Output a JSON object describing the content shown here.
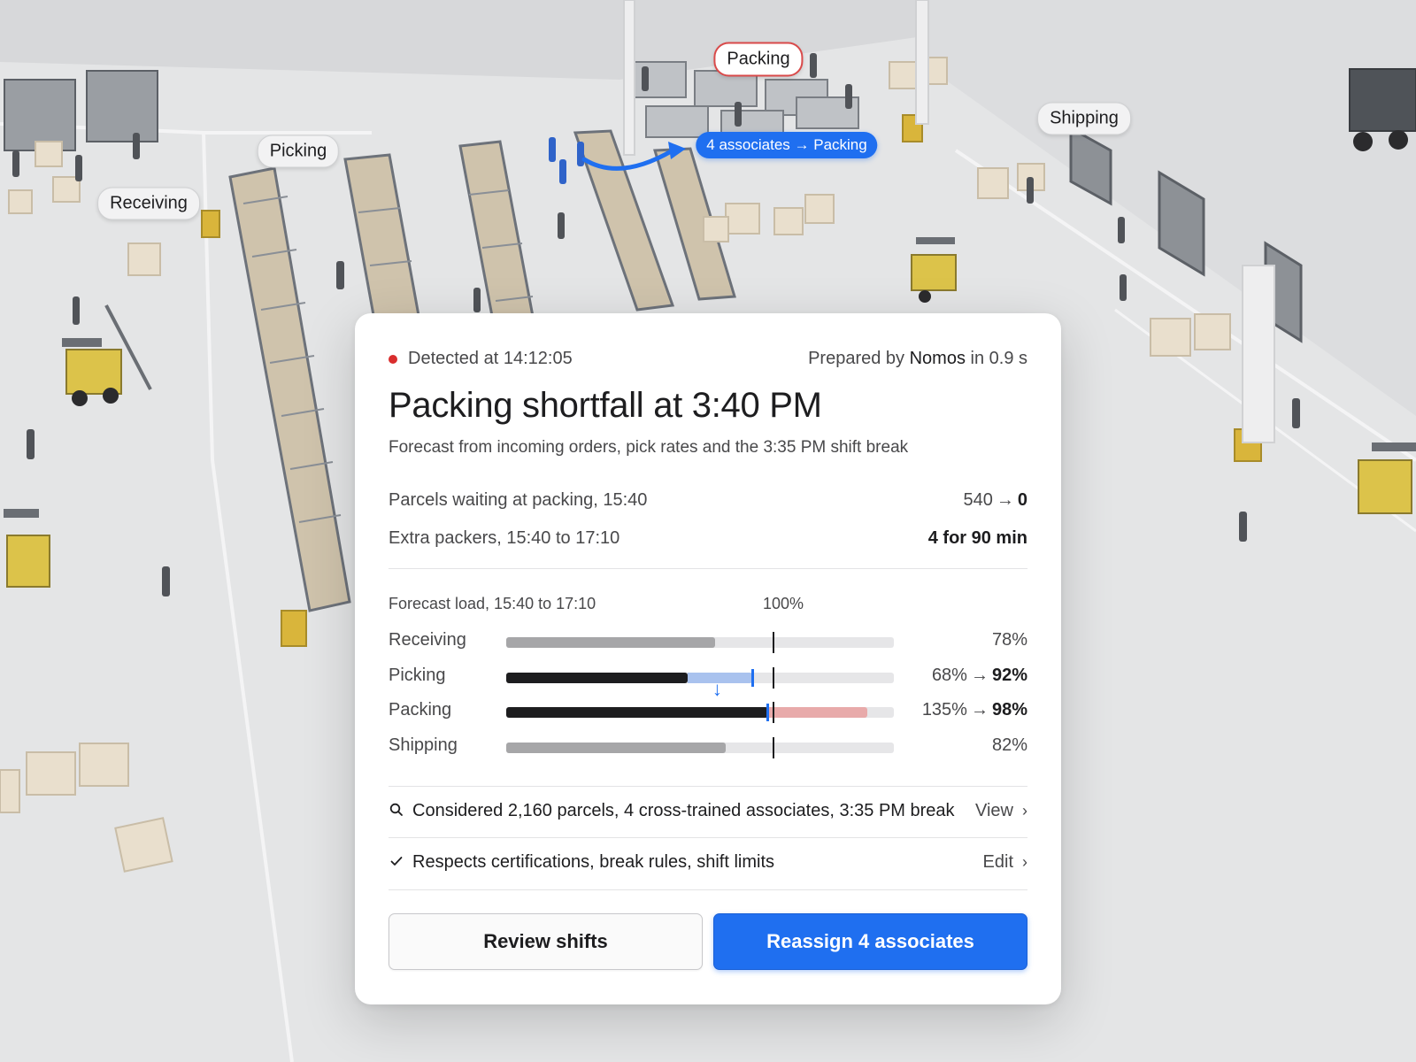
{
  "map": {
    "zones": {
      "receiving": "Receiving",
      "picking": "Picking",
      "packing": "Packing",
      "shipping": "Shipping"
    },
    "move_pill": "4 associates → Packing"
  },
  "card": {
    "detected": "Detected at 14:12:05",
    "prepared_prefix": "Prepared by ",
    "prepared_brand": "Nomos",
    "prepared_suffix": " in 0.9 s",
    "title": "Packing shortfall at 3:40 PM",
    "subtitle": "Forecast from incoming orders, pick rates and the 3:35 PM shift break",
    "stats": [
      {
        "label": "Parcels waiting at packing, 15:40",
        "from": "540",
        "arrow": "→",
        "to": "0"
      },
      {
        "label": "Extra packers, 15:40 to 17:10",
        "value": "4 for 90 min"
      }
    ],
    "load": {
      "header": "Forecast load, 15:40 to 17:10",
      "reference_label": "100%",
      "reference": 1.0,
      "max": 1.45,
      "rows": [
        {
          "label": "Receiving",
          "current": 0.78,
          "text": "78%"
        },
        {
          "label": "Picking",
          "current": 0.68,
          "after": 0.92,
          "text_from": "68%",
          "arrow": "→",
          "text_to": "92%"
        },
        {
          "label": "Packing",
          "current": 1.35,
          "after": 0.98,
          "text_from": "135%",
          "arrow": "→",
          "text_to": "98%"
        },
        {
          "label": "Shipping",
          "current": 0.82,
          "text": "82%"
        }
      ],
      "transfer_arrow": "↓"
    },
    "considered": {
      "icon": "search-icon",
      "text": "Considered 2,160 parcels, 4 cross-trained associates, 3:35 PM break",
      "link": "View"
    },
    "constraints": {
      "icon": "check-icon",
      "text": "Respects certifications, break rules, shift limits",
      "link": "Edit"
    },
    "chevron": "›",
    "buttons": {
      "secondary": "Review shifts",
      "primary": "Reassign 4 associates"
    },
    "colors": {
      "accent": "#1f6ff0",
      "alert": "#d92d2d",
      "over": "#e8aaaa",
      "added": "#a9c2ee"
    }
  }
}
